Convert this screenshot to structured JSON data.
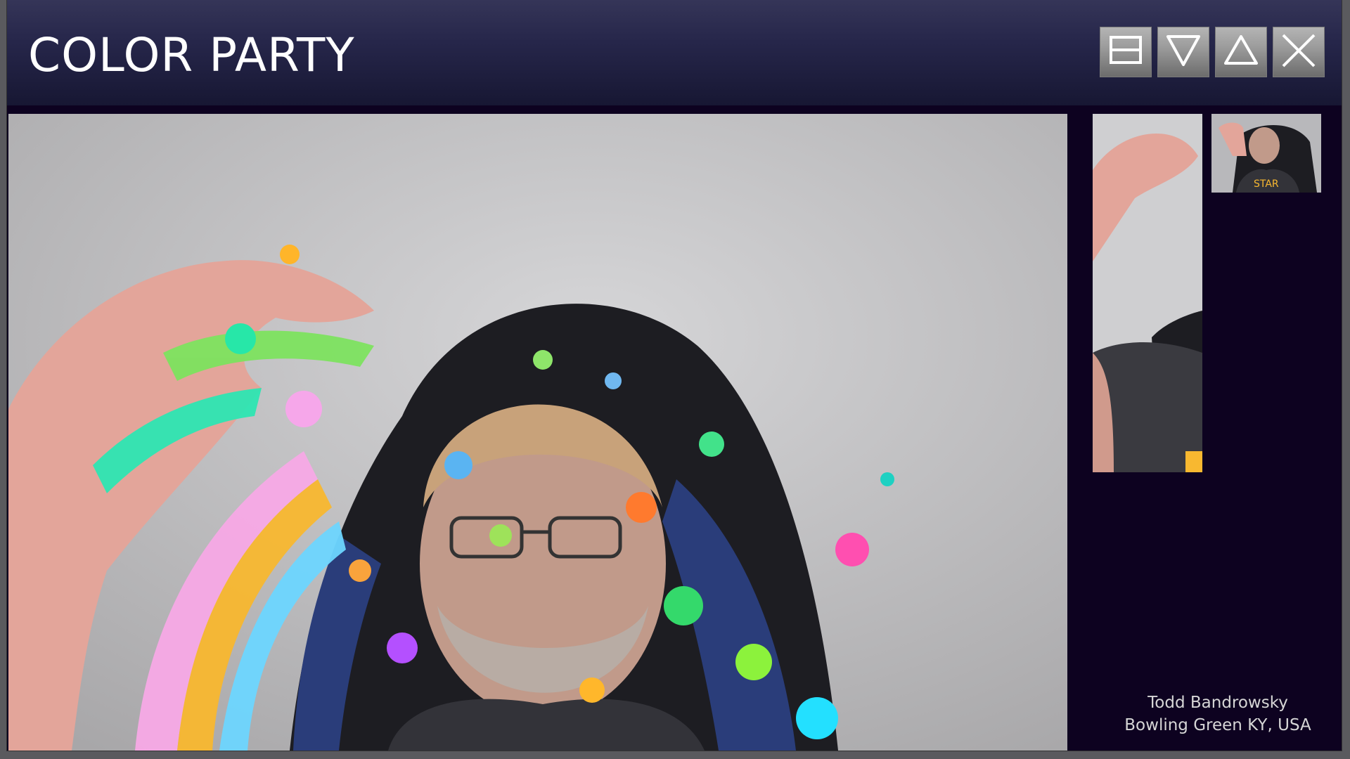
{
  "app": {
    "title": "COLOR PARTY"
  },
  "window_controls": [
    {
      "name": "layout",
      "icon": "layout-icon"
    },
    {
      "name": "minimize",
      "icon": "triangle-down-icon"
    },
    {
      "name": "maximize",
      "icon": "triangle-up-icon"
    },
    {
      "name": "close",
      "icon": "close-x-icon"
    }
  ],
  "participant": {
    "name": "Todd Bandrowsky",
    "location": "Bowling Green KY, USA"
  },
  "colors": {
    "titlebar_top": "#353558",
    "titlebar_bottom": "#171733",
    "background": "#0d0220",
    "caption_text": "#d6d6d6"
  }
}
